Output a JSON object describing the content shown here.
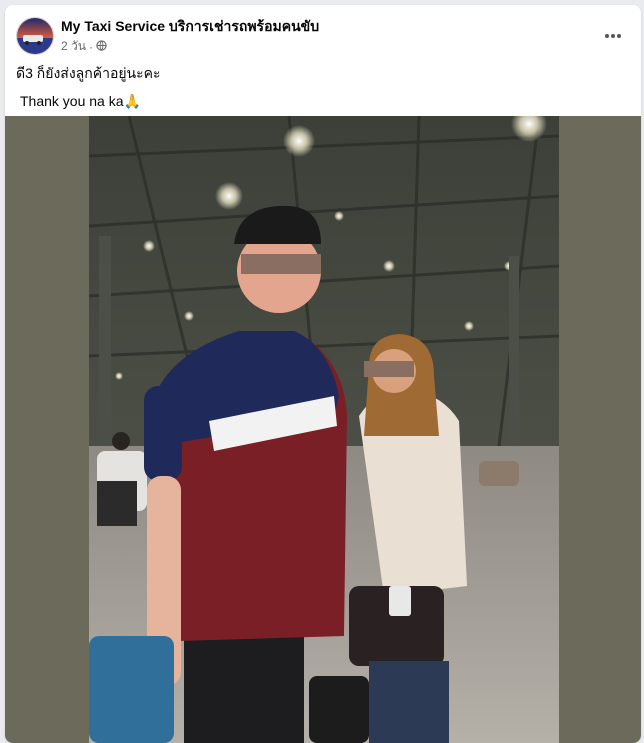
{
  "post": {
    "page_name": "My Taxi Service บริการเช่ารถพร้อมคนขับ",
    "time": "2 วัน",
    "separator": "·",
    "privacy_icon": "globe-icon",
    "more_icon": "more-options-icon",
    "text_line_1": "ดี3 ก็ยังส่งลูกค้าอยู่นะคะ",
    "text_line_2": "Thank you na ka🙏"
  },
  "colors": {
    "card_bg": "#ffffff",
    "page_bg": "#e9ebee",
    "meta_gray": "#65676b",
    "photo_side_bg": "#6b6a5b"
  }
}
